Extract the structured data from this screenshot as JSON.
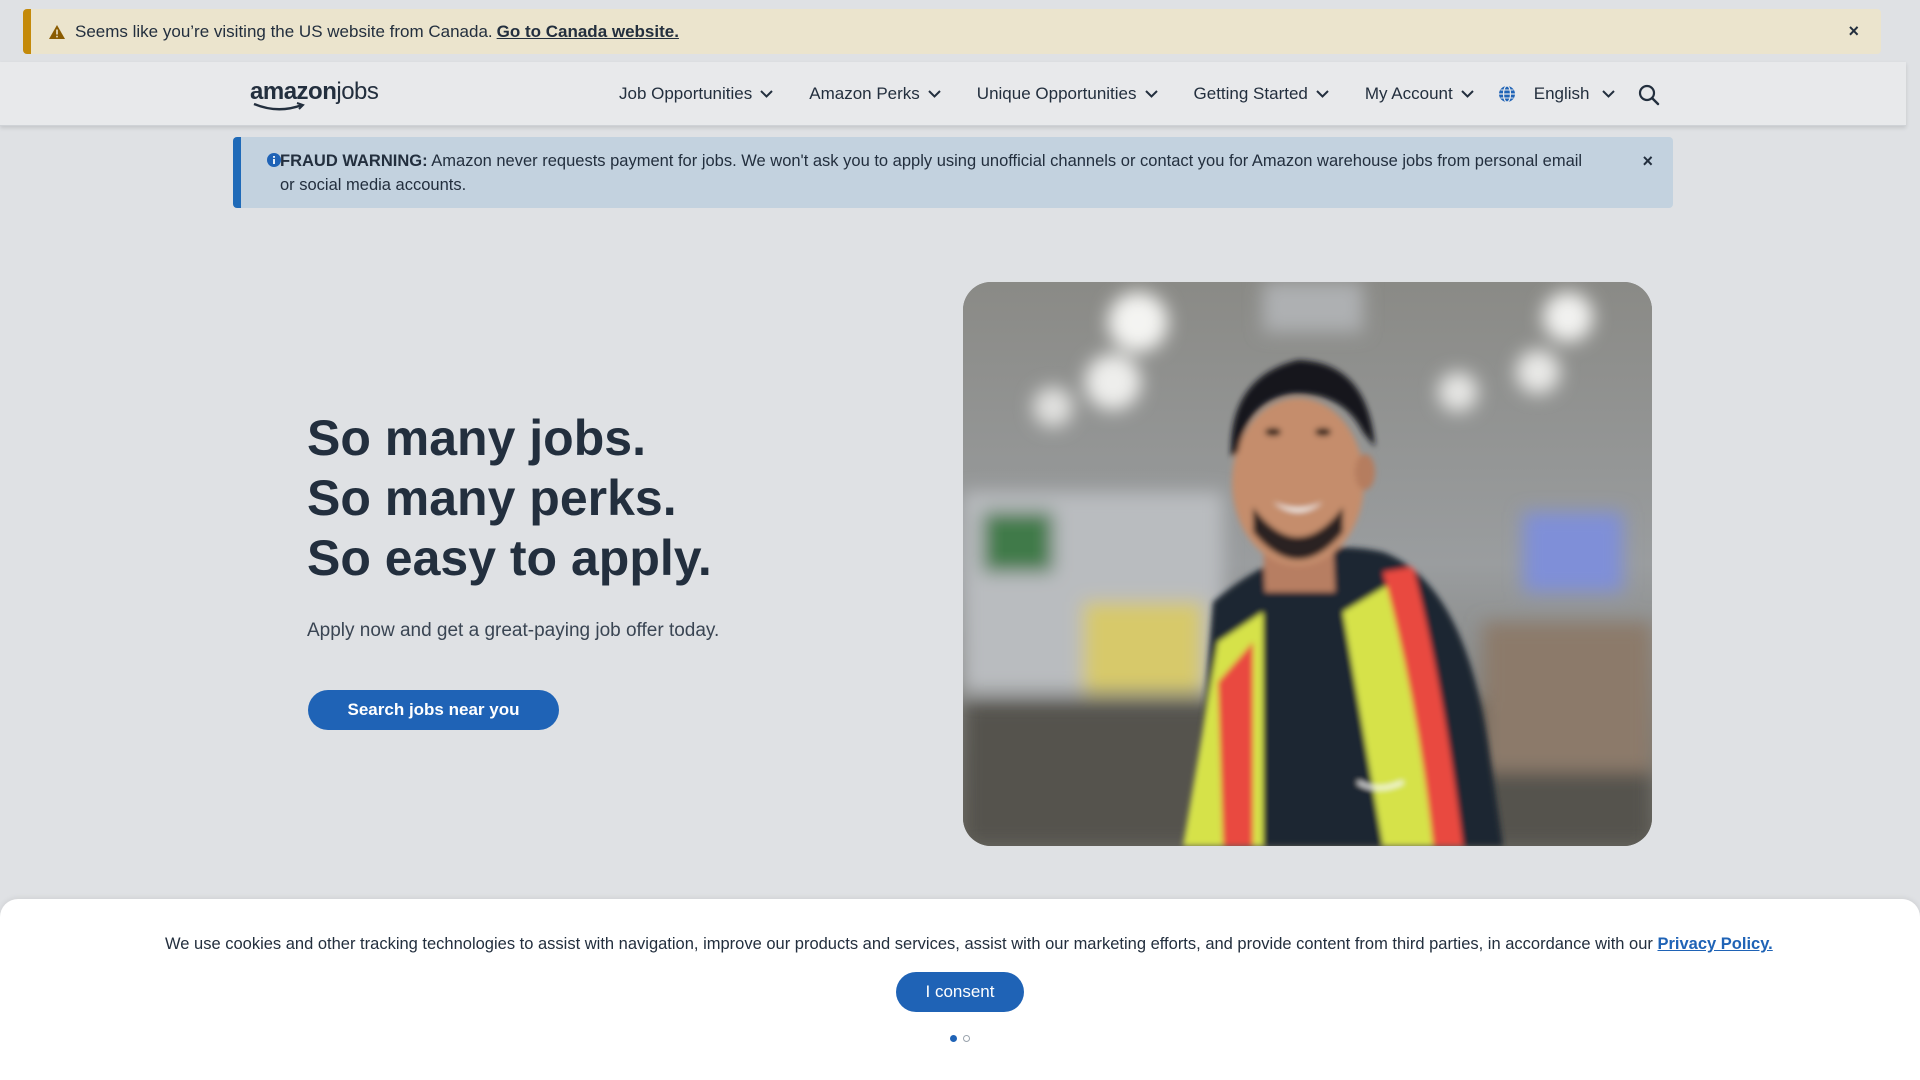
{
  "country_banner": {
    "message": "Seems like you’re visiting the US website from Canada.",
    "link_label": "Go to Canada website.",
    "close_label": "×"
  },
  "header": {
    "logo_primary": "amazon",
    "logo_secondary": "jobs",
    "nav": [
      {
        "label": "Job Opportunities"
      },
      {
        "label": "Amazon Perks"
      },
      {
        "label": "Unique Opportunities"
      },
      {
        "label": "Getting Started"
      },
      {
        "label": "My Account"
      }
    ],
    "language": "English"
  },
  "fraud_warning": {
    "heading": "FRAUD WARNING:",
    "message": "Amazon never requests payment for jobs. We won't ask you to apply using unofficial channels or contact you for Amazon warehouse jobs from personal email or social media accounts.",
    "close_label": "×"
  },
  "hero": {
    "title_lines": [
      "So many jobs.",
      "So many perks.",
      "So easy to apply."
    ],
    "subtitle": "Apply now and get a great-paying job offer today.",
    "cta_label": "Search jobs near you"
  },
  "cookie_bar": {
    "message": "We use cookies and other tracking technologies to assist with navigation, improve our products and services, assist with our marketing efforts, and provide content from third parties, in accordance with our",
    "link_label": "Privacy Policy.",
    "consent_label": "I consent",
    "pages_total": 2,
    "active_page": 1
  },
  "colors": {
    "accent": "#1f63b6",
    "warning_border": "#c48a0a",
    "info_border": "#1f6ab8",
    "text": "#232f3e"
  },
  "icons": {
    "warning": "warning-triangle-icon",
    "info": "info-circle-icon",
    "globe": "globe-icon",
    "search": "search-icon",
    "chevron": "chevron-down-icon",
    "close": "close-icon"
  }
}
